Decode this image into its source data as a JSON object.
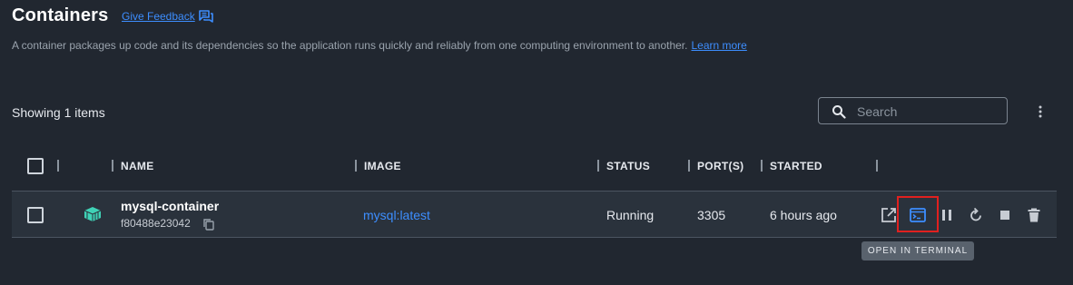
{
  "page": {
    "title": "Containers",
    "give_feedback": "Give Feedback",
    "description": "A container packages up code and its dependencies so the application runs quickly and reliably from one computing environment to another.",
    "learn_more": "Learn more"
  },
  "toolbar": {
    "showing": "Showing 1 items",
    "search_placeholder": "Search"
  },
  "table": {
    "headers": {
      "name": "NAME",
      "image": "IMAGE",
      "status": "STATUS",
      "ports": "PORT(S)",
      "started": "STARTED"
    },
    "rows": [
      {
        "name": "mysql-container",
        "id": "f80488e23042",
        "image": "mysql:latest",
        "status": "Running",
        "ports": "3305",
        "started": "6 hours ago"
      }
    ]
  },
  "tooltip": "OPEN IN TERMINAL",
  "icons": {
    "feedback": "feedback-icon",
    "search": "search-icon",
    "menu": "kebab-menu-icon",
    "container": "container-icon",
    "copy": "copy-icon",
    "open_browser": "open-in-browser-icon",
    "terminal": "terminal-icon",
    "pause": "pause-icon",
    "restart": "restart-icon",
    "stop": "stop-icon",
    "delete": "delete-icon"
  },
  "colors": {
    "background": "#212730",
    "row": "#2a323c",
    "link": "#3d8eff",
    "container_icon": "#3fd2b6",
    "highlight": "#e0201f"
  }
}
